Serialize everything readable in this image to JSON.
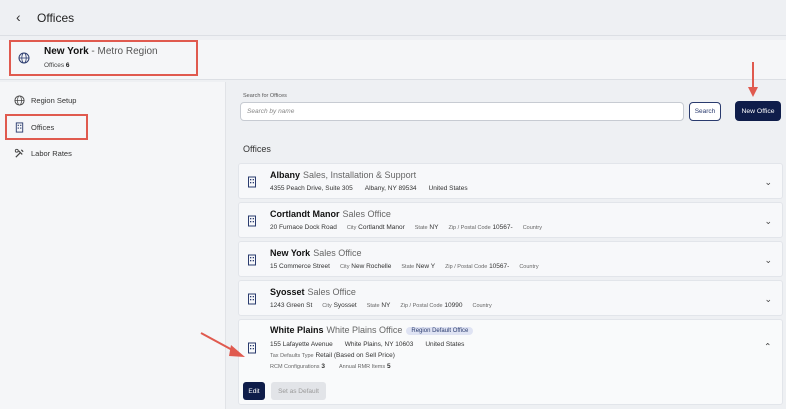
{
  "header": {
    "title": "Offices"
  },
  "region": {
    "name": "New York",
    "suffix": " - Metro Region",
    "count_label": "Offices",
    "count": "6"
  },
  "sidebar": {
    "items": [
      {
        "label": "Region Setup"
      },
      {
        "label": "Offices"
      },
      {
        "label": "Labor Rates"
      }
    ]
  },
  "search": {
    "label": "Search for Offices",
    "placeholder": "Search by name",
    "button": "Search"
  },
  "new_office": "New Office",
  "offices_heading": "Offices",
  "offices": [
    {
      "name": "Albany",
      "type": "Sales, Installation & Support",
      "street": "4355 Peach Drive, Suite 305",
      "city_line": "Albany, NY 89534",
      "country": "United States"
    },
    {
      "name": "Cortlandt Manor",
      "type": "Sales Office",
      "street": "20 Furnace Dock Road",
      "city_label": "City",
      "city": "Cortlandt Manor",
      "state_label": "State",
      "state": "NY",
      "zip_label": "Zip / Postal Code",
      "zip": "10567-",
      "country_label": "Country"
    },
    {
      "name": "New York",
      "type": "Sales Office",
      "street": "15 Commerce Street",
      "city_label": "City",
      "city": "New Rochelle",
      "state_label": "State",
      "state": "New Y",
      "zip_label": "Zip / Postal Code",
      "zip": "10567-",
      "country_label": "Country"
    },
    {
      "name": "Syosset",
      "type": "Sales Office",
      "street": "1243 Green St",
      "city_label": "City",
      "city": "Syosset",
      "state_label": "State",
      "state": "NY",
      "zip_label": "Zip / Postal Code",
      "zip": "10990",
      "country_label": "Country"
    },
    {
      "name": "White Plains",
      "type": "White Plains Office",
      "badge": "Region Default Office",
      "street": "155 Lafayette Avenue",
      "city_line": "White Plains, NY 10603",
      "country": "United States",
      "tax_label": "Tax Defaults Type",
      "tax_value": "Retail (Based on Sell Price)",
      "rcm_label": "RCM Configurations",
      "rcm_value": "3",
      "rmr_label": "Annual RMR Items",
      "rmr_value": "5",
      "edit": "Edit",
      "set_default": "Set as Default"
    }
  ],
  "colors": {
    "primary": "#0f1d4a",
    "annotation": "#e05a4f"
  }
}
